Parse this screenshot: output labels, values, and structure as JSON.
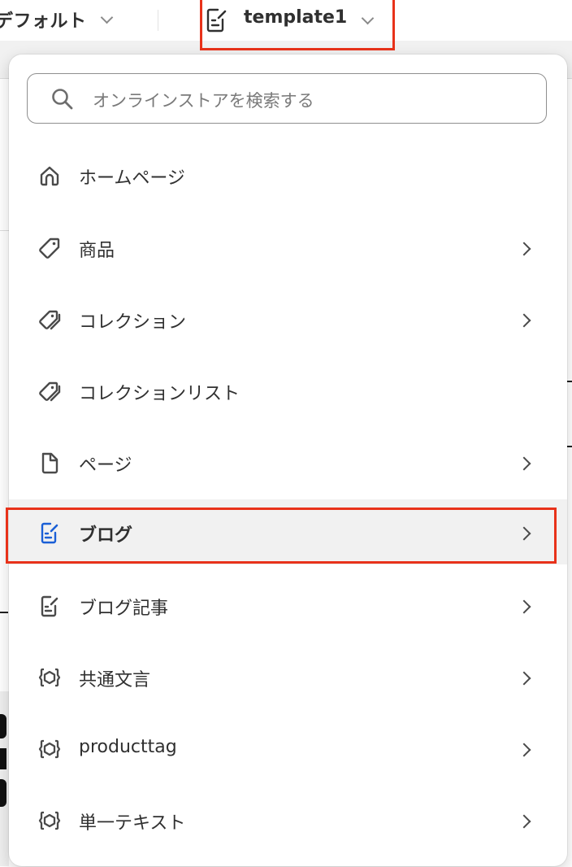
{
  "topbar": {
    "theme_label": "デフォルト",
    "template_label": "template1"
  },
  "search": {
    "placeholder": "オンラインストアを検索する"
  },
  "menu": {
    "items": [
      {
        "label": "ホームページ",
        "icon": "home-icon",
        "has_chevron": false
      },
      {
        "label": "商品",
        "icon": "tag-icon",
        "has_chevron": true
      },
      {
        "label": "コレクション",
        "icon": "tags-icon",
        "has_chevron": true
      },
      {
        "label": "コレクションリスト",
        "icon": "tags-icon",
        "has_chevron": false
      },
      {
        "label": "ページ",
        "icon": "page-icon",
        "has_chevron": true
      },
      {
        "label": "ブログ",
        "icon": "blog-icon",
        "has_chevron": true,
        "active": true
      },
      {
        "label": "ブログ記事",
        "icon": "blog-icon",
        "has_chevron": true
      },
      {
        "label": "共通文言",
        "icon": "metaobject-icon",
        "has_chevron": true
      },
      {
        "label": "producttag",
        "icon": "metaobject-icon",
        "has_chevron": true
      },
      {
        "label": "単一テキスト",
        "icon": "metaobject-icon",
        "has_chevron": true
      }
    ]
  },
  "colors": {
    "highlight_border": "#e8321a",
    "active_icon": "#1a5fd6",
    "active_bg": "#f1f1f1"
  }
}
